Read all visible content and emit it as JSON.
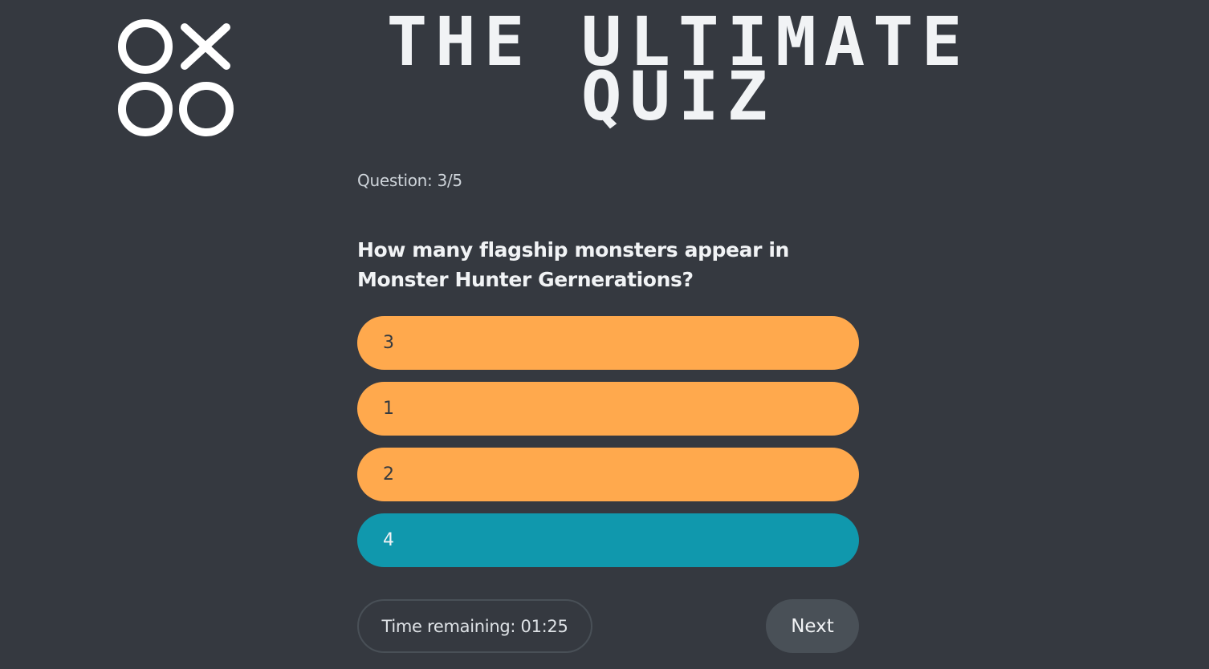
{
  "header": {
    "logo_icon": "tic-tac-toe-logo-icon",
    "title_line1": "THE ULTIMATE",
    "title_line2": "QUIZ"
  },
  "quiz": {
    "counter": "Question: 3/5",
    "question": "How many flagship monsters appear in Monster Hunter Gernerations?",
    "options": [
      {
        "label": "3",
        "selected": false
      },
      {
        "label": "1",
        "selected": false
      },
      {
        "label": "2",
        "selected": false
      },
      {
        "label": "4",
        "selected": true
      }
    ]
  },
  "footer": {
    "timer": "Time remaining: 01:25",
    "next_label": "Next"
  },
  "colors": {
    "background": "#353940",
    "option": "#ffa94d",
    "option_selected": "#1098ad",
    "button": "#495057",
    "text_light": "#f1f3f5"
  }
}
